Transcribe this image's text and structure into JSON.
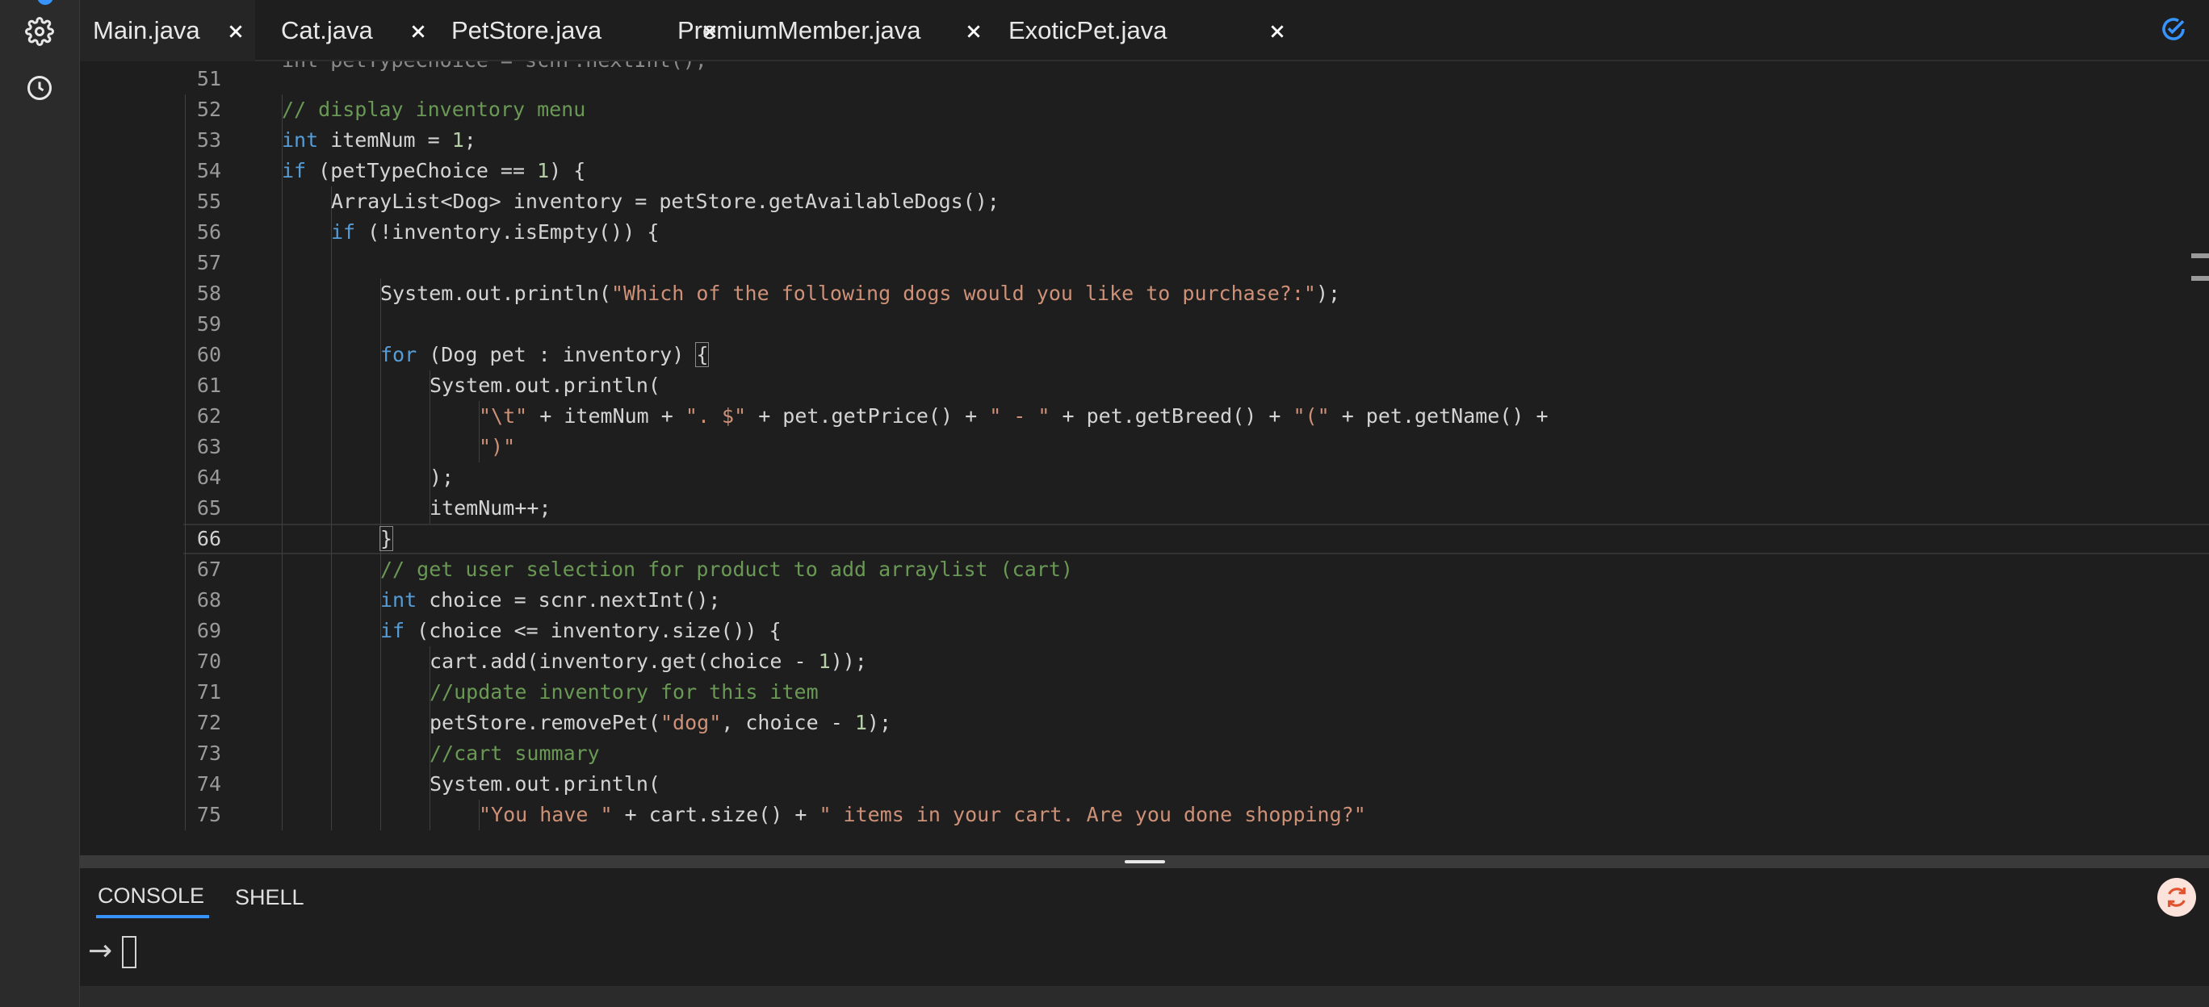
{
  "tabs": [
    {
      "label": "Main.java",
      "active": true
    },
    {
      "label": "Cat.java",
      "active": false
    },
    {
      "label": "PetStore.java",
      "active": false
    },
    {
      "label": "PremiumMember.java",
      "active": false
    },
    {
      "label": "ExoticPet.java",
      "active": false
    }
  ],
  "rail": {
    "icons": [
      "settings-icon",
      "history-icon"
    ]
  },
  "colors": {
    "accent": "#3794ff",
    "keyword": "#569cd6",
    "string": "#ce9178",
    "comment": "#6a9955",
    "number": "#b5cea8"
  },
  "editor": {
    "current_line": "66",
    "partial_line": "int petTypeChoice = scnr.nextInt();",
    "lines": [
      {
        "n": "51",
        "indent": 0,
        "tokens": []
      },
      {
        "n": "52",
        "indent": 2,
        "tokens": [
          {
            "t": "// display inventory menu",
            "k": "cm"
          }
        ]
      },
      {
        "n": "53",
        "indent": 2,
        "tokens": [
          {
            "t": "int",
            "k": "kw"
          },
          {
            "t": " itemNum = "
          },
          {
            "t": "1",
            "k": "num"
          },
          {
            "t": ";"
          }
        ]
      },
      {
        "n": "54",
        "indent": 2,
        "tokens": [
          {
            "t": "if",
            "k": "kw"
          },
          {
            "t": " (petTypeChoice == "
          },
          {
            "t": "1",
            "k": "num"
          },
          {
            "t": ") {"
          }
        ]
      },
      {
        "n": "55",
        "indent": 3,
        "tokens": [
          {
            "t": "ArrayList<Dog> inventory = petStore.getAvailableDogs();"
          }
        ]
      },
      {
        "n": "56",
        "indent": 3,
        "tokens": [
          {
            "t": "if",
            "k": "kw"
          },
          {
            "t": " (!inventory.isEmpty()) {"
          }
        ]
      },
      {
        "n": "57",
        "indent": 0,
        "tokens": []
      },
      {
        "n": "58",
        "indent": 4,
        "tokens": [
          {
            "t": "System.out.println("
          },
          {
            "t": "\"Which of the following dogs would you like to purchase?:\"",
            "k": "str"
          },
          {
            "t": ");"
          }
        ]
      },
      {
        "n": "59",
        "indent": 0,
        "tokens": []
      },
      {
        "n": "60",
        "indent": 4,
        "tokens": [
          {
            "t": "for",
            "k": "kw"
          },
          {
            "t": " (Dog pet : inventory) "
          },
          {
            "t": "{",
            "k": "box"
          }
        ]
      },
      {
        "n": "61",
        "indent": 5,
        "tokens": [
          {
            "t": "System.out.println("
          }
        ]
      },
      {
        "n": "62",
        "indent": 6,
        "tokens": [
          {
            "t": "\"\\t\"",
            "k": "str"
          },
          {
            "t": " + itemNum + "
          },
          {
            "t": "\". $\"",
            "k": "str"
          },
          {
            "t": " + pet.getPrice() + "
          },
          {
            "t": "\" - \"",
            "k": "str"
          },
          {
            "t": " + pet.getBreed() + "
          },
          {
            "t": "\"(\"",
            "k": "str"
          },
          {
            "t": " + pet.getName() +"
          }
        ]
      },
      {
        "n": "63",
        "indent": 6,
        "tokens": [
          {
            "t": "\")\"",
            "k": "str"
          }
        ]
      },
      {
        "n": "64",
        "indent": 5,
        "tokens": [
          {
            "t": ");"
          }
        ]
      },
      {
        "n": "65",
        "indent": 5,
        "tokens": [
          {
            "t": "itemNum++;"
          }
        ]
      },
      {
        "n": "66",
        "indent": 4,
        "tokens": [
          {
            "t": "}",
            "k": "box"
          }
        ]
      },
      {
        "n": "67",
        "indent": 4,
        "tokens": [
          {
            "t": "// get user selection for product to add arraylist (cart)",
            "k": "cm"
          }
        ]
      },
      {
        "n": "68",
        "indent": 4,
        "tokens": [
          {
            "t": "int",
            "k": "kw"
          },
          {
            "t": " choice = scnr.nextInt();"
          }
        ]
      },
      {
        "n": "69",
        "indent": 4,
        "tokens": [
          {
            "t": "if",
            "k": "kw"
          },
          {
            "t": " (choice <= inventory.size()) {"
          }
        ]
      },
      {
        "n": "70",
        "indent": 5,
        "tokens": [
          {
            "t": "cart.add(inventory.get(choice - "
          },
          {
            "t": "1",
            "k": "num"
          },
          {
            "t": "));"
          }
        ]
      },
      {
        "n": "71",
        "indent": 5,
        "tokens": [
          {
            "t": "//update inventory for this item",
            "k": "cm"
          }
        ]
      },
      {
        "n": "72",
        "indent": 5,
        "tokens": [
          {
            "t": "petStore.removePet("
          },
          {
            "t": "\"dog\"",
            "k": "str"
          },
          {
            "t": ", choice - "
          },
          {
            "t": "1",
            "k": "num"
          },
          {
            "t": ");"
          }
        ]
      },
      {
        "n": "73",
        "indent": 5,
        "tokens": [
          {
            "t": "//cart summary",
            "k": "cm"
          }
        ]
      },
      {
        "n": "74",
        "indent": 5,
        "tokens": [
          {
            "t": "System.out.println("
          }
        ]
      },
      {
        "n": "75",
        "indent": 6,
        "tokens": [
          {
            "t": "\"You have \"",
            "k": "str"
          },
          {
            "t": " + cart.size() + "
          },
          {
            "t": "\" items in your cart. Are you done shopping?\"",
            "k": "str"
          }
        ]
      }
    ]
  },
  "panel": {
    "tabs": [
      {
        "label": "CONSOLE",
        "active": true
      },
      {
        "label": "SHELL",
        "active": false
      }
    ],
    "prompt": "→"
  }
}
